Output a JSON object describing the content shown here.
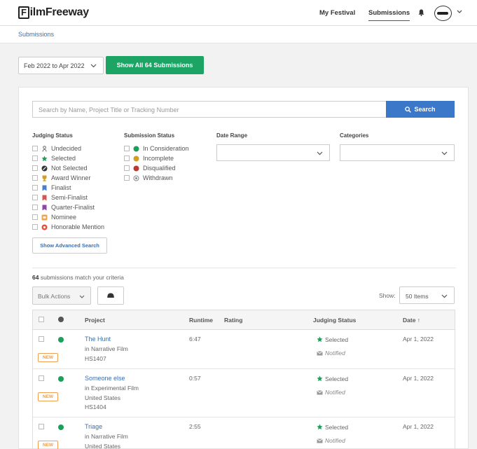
{
  "header": {
    "logo_text": "ilmFreeway",
    "logo_letter": "F",
    "nav": [
      "My Festival",
      "Submissions"
    ]
  },
  "breadcrumb": "Submissions",
  "toolbar": {
    "date_range": "Feb 2022 to Apr 2022",
    "show_all_label": "Show All 64 Submissions"
  },
  "search": {
    "placeholder": "Search by Name, Project Title or Tracking Number",
    "button_label": "Search"
  },
  "filters": {
    "judging_heading": "Judging Status",
    "judging_options": [
      "Undecided",
      "Selected",
      "Not Selected",
      "Award Winner",
      "Finalist",
      "Semi-Finalist",
      "Quarter-Finalist",
      "Nominee",
      "Honorable Mention"
    ],
    "submission_heading": "Submission Status",
    "submission_options": [
      "In Consideration",
      "Incomplete",
      "Disqualified",
      "Withdrawn"
    ],
    "date_heading": "Date Range",
    "categories_heading": "Categories",
    "advanced_search_label": "Show Advanced Search"
  },
  "results": {
    "count": "64",
    "count_suffix": "submissions match your criteria",
    "bulk_actions": "Bulk Actions",
    "show_label": "Show:",
    "page_size": "50 Items"
  },
  "table": {
    "columns": {
      "project": "Project",
      "runtime": "Runtime",
      "rating": "Rating",
      "judging": "Judging Status",
      "date": "Date ↑"
    },
    "rows": [
      {
        "badge": "NEW",
        "title": "The Hunt",
        "lines": [
          "in Narrative Film",
          "HS1407"
        ],
        "runtime": "6:47",
        "judging": "Selected",
        "notified": "Notified",
        "date": "Apr 1, 2022"
      },
      {
        "badge": "NEW",
        "title": "Someone else",
        "lines": [
          "in Experimental Film",
          "United States",
          "HS1404"
        ],
        "runtime": "0:57",
        "judging": "Selected",
        "notified": "Notified",
        "date": "Apr 1, 2022"
      },
      {
        "badge": "NEW",
        "title": "Triage",
        "lines": [
          "in Narrative Film",
          "United States"
        ],
        "runtime": "2:55",
        "judging": "Selected",
        "notified": "Notified",
        "date": "Apr 1, 2022"
      }
    ]
  },
  "colors": {
    "primary_green": "#1ba463",
    "link_blue": "#3a6fb0",
    "search_blue": "#3b78c9",
    "badge_orange": "#f0a050"
  }
}
